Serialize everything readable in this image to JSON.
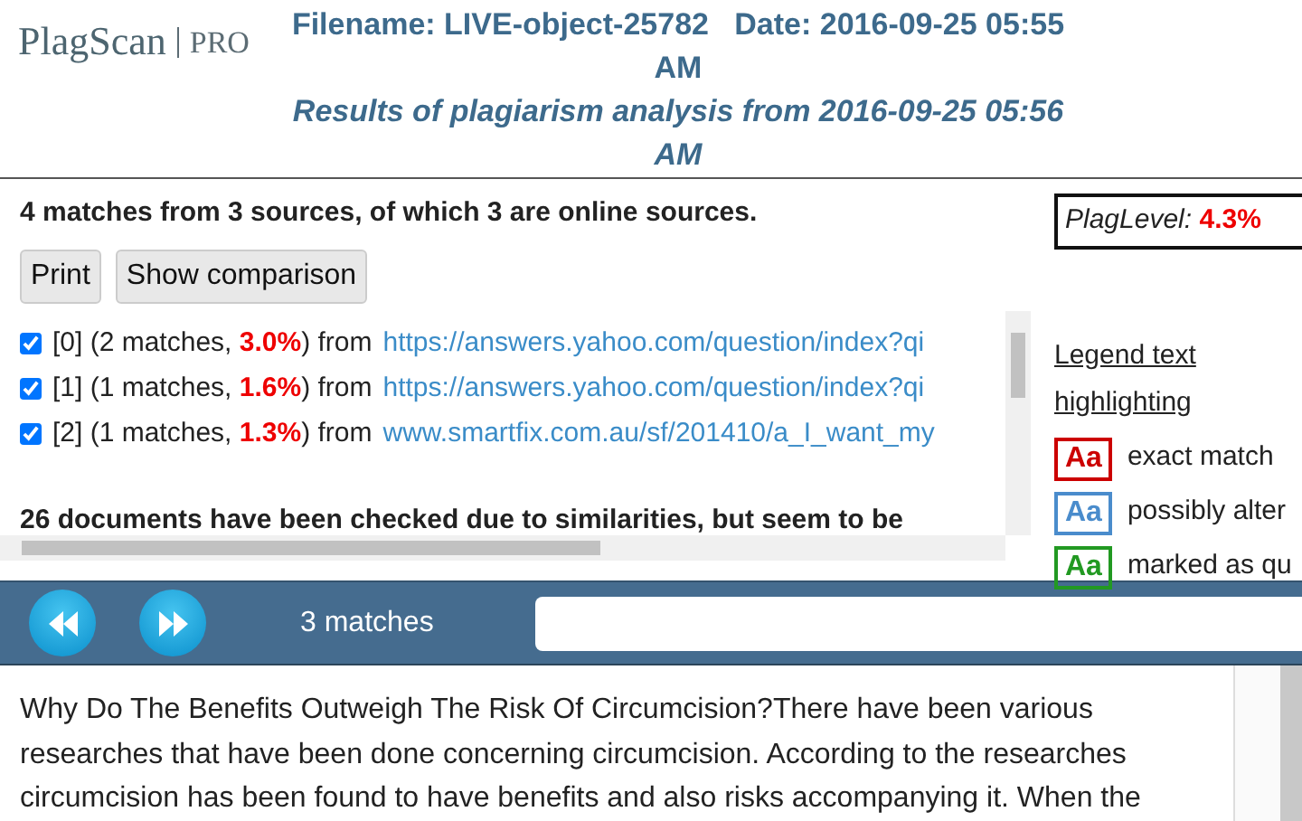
{
  "header": {
    "logo": "PlagScan",
    "edition": "PRO",
    "file_line": "Filename: LIVE-object-25782   Date: 2016-09-25 05:55 AM",
    "results_line": "Results of plagiarism analysis from 2016-09-25 05:56 AM"
  },
  "summary": "4 matches from 3 sources, of which 3 are online sources.",
  "plag_level": {
    "label": "PlagLevel:",
    "value": "4.3%"
  },
  "buttons": [
    "Print",
    "Show comparison"
  ],
  "sources": [
    {
      "index": "[0]",
      "matches": "(2 matches, ",
      "percent": "3.0%",
      "from": ") from",
      "url": "https://answers.yahoo.com/question/index?qi",
      "checked": true
    },
    {
      "index": "[1]",
      "matches": "(1 matches, ",
      "percent": "1.6%",
      "from": ") from",
      "url": "https://answers.yahoo.com/question/index?qi",
      "checked": true
    },
    {
      "index": "[2]",
      "matches": "(1 matches, ",
      "percent": "1.3%",
      "from": ") from",
      "url": "www.smartfix.com.au/sf/201410/a_I_want_my",
      "checked": true
    }
  ],
  "checked_note": "26 documents have been checked due to similarities, but seem to be",
  "legend": {
    "title": "Legend text highlighting",
    "items": [
      {
        "sample": "Aa",
        "label": "exact match",
        "color": "#cc0000"
      },
      {
        "sample": "Aa",
        "label": "possibly alter",
        "color": "#4a8ccc"
      },
      {
        "sample": "Aa",
        "label": "marked as qu",
        "color": "#229922"
      }
    ]
  },
  "toolbar": {
    "match_count": "3 matches"
  },
  "document_text": "Why Do The Benefits Outweigh The Risk Of Circumcision?There have been various researches that have been done concerning circumcision. According to the researches circumcision has been found to have benefits and also risks accompanying it. When the"
}
